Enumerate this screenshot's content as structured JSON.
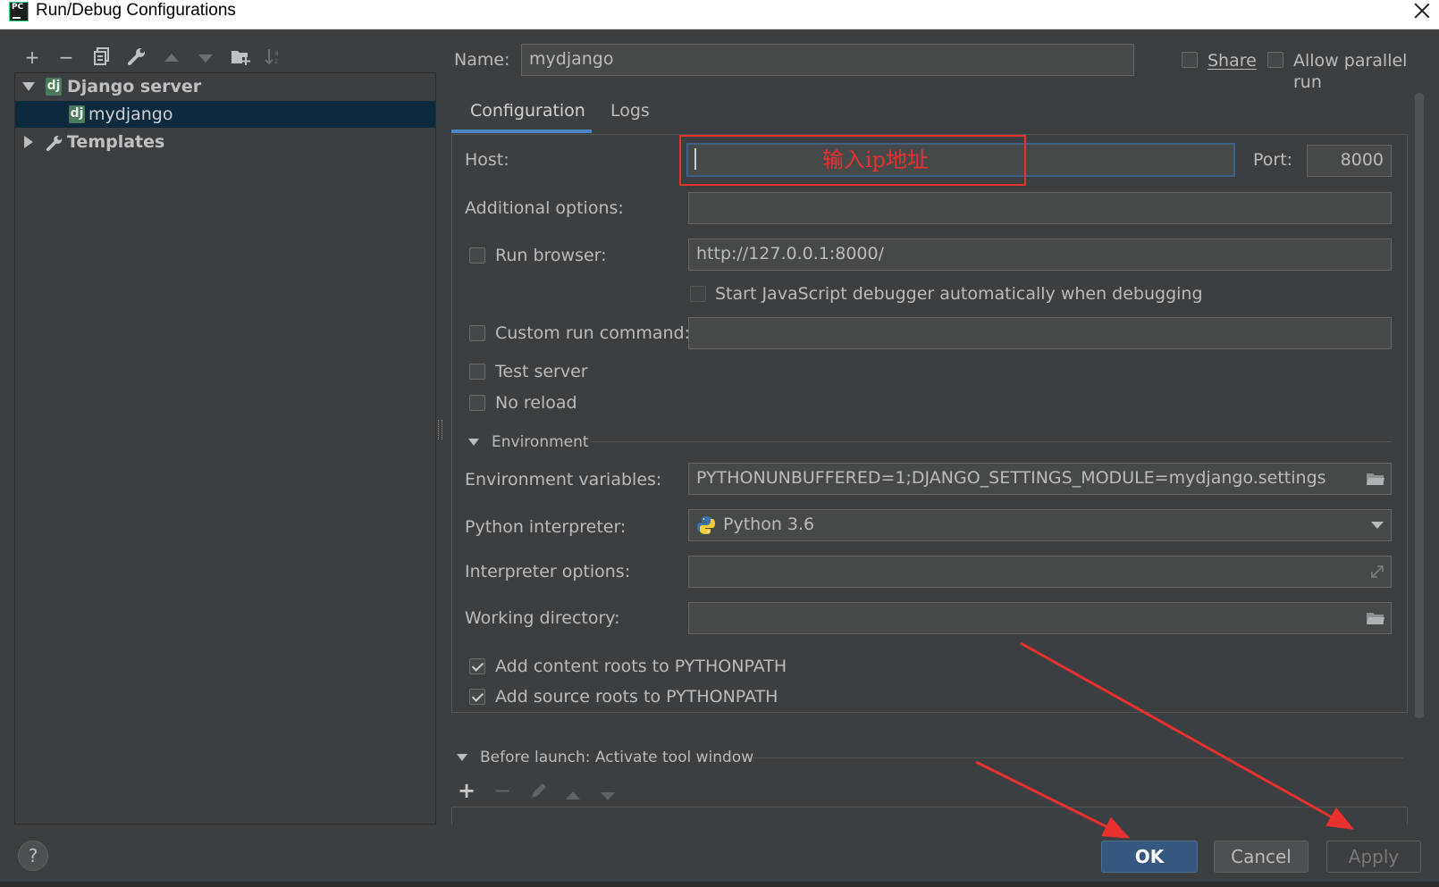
{
  "window": {
    "title": "Run/Debug Configurations",
    "app_icon": "PC"
  },
  "left_toolbar": {
    "icons": [
      "add-icon",
      "remove-icon",
      "copy-icon",
      "wrench-icon",
      "move-up-icon",
      "move-down-icon",
      "new-folder-icon",
      "sort-icon"
    ]
  },
  "tree": {
    "items": [
      {
        "label": "Django server",
        "icon": "dj",
        "expanded": true
      },
      {
        "label": "mydjango",
        "icon": "dj",
        "selected": true
      },
      {
        "label": "Templates",
        "icon": "wrench-icon",
        "expanded": false
      }
    ]
  },
  "header": {
    "name_label": "Name:",
    "name_value": "mydjango",
    "share_label": "Share",
    "share_checked": false,
    "parallel_label": "Allow parallel run",
    "parallel_checked": false
  },
  "tabs": [
    {
      "label": "Configuration",
      "active": true
    },
    {
      "label": "Logs",
      "active": false
    }
  ],
  "config": {
    "host_label": "Host:",
    "host_value": "",
    "port_label": "Port:",
    "port_value": "8000",
    "additional_options_label": "Additional options:",
    "additional_options_value": "",
    "run_browser_label": "Run browser:",
    "run_browser_checked": false,
    "run_browser_url": "http://127.0.0.1:8000/",
    "js_debugger_label": "Start JavaScript debugger automatically when debugging",
    "custom_run_label": "Custom run command:",
    "custom_run_value": "",
    "test_server_label": "Test server",
    "no_reload_label": "No reload"
  },
  "environment": {
    "section_label": "Environment",
    "env_vars_label": "Environment variables:",
    "env_vars_value": "PYTHONUNBUFFERED=1;DJANGO_SETTINGS_MODULE=mydjango.settings",
    "interpreter_label": "Python interpreter:",
    "interpreter_value": "Python 3.6",
    "interpreter_options_label": "Interpreter options:",
    "interpreter_options_value": "",
    "working_dir_label": "Working directory:",
    "working_dir_value": "",
    "content_roots_label": "Add content roots to PYTHONPATH",
    "content_roots_checked": true,
    "source_roots_label": "Add source roots to PYTHONPATH",
    "source_roots_checked": true
  },
  "before_launch": {
    "label": "Before launch: Activate tool window"
  },
  "buttons": {
    "ok": "OK",
    "cancel": "Cancel",
    "apply": "Apply",
    "help": "?"
  },
  "annotation": {
    "text": "输入ip地址",
    "color": "#e8302f"
  },
  "colors": {
    "background": "#3c3f41",
    "selection": "#0d293e",
    "accent": "#4a88c7",
    "primary_button": "#365880"
  }
}
